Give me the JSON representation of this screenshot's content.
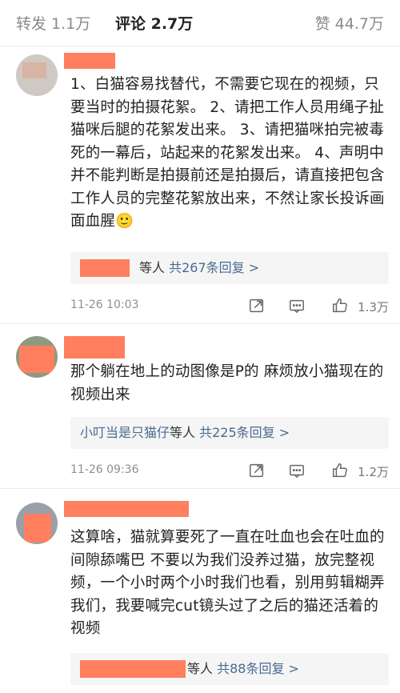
{
  "tabs": {
    "repost": "转发 1.1万",
    "comments": "评论 2.7万",
    "likes": "赞 44.7万"
  },
  "comments": [
    {
      "text": "1、白猫容易找替代，不需要它现在的视频，只要当时的拍摄花絮。 2、请把工作人员用绳子扯猫咪后腿的花絮发出来。 3、请把猫咪拍完被毒死的一幕后，站起来的花絮发出来。 4、声明中并不能判断是拍摄前还是拍摄后，请直接把包含工作人员的完整花絮放出来，不然让家长投诉画面血腥🙂",
      "reply_suffix": "等人",
      "reply_link": "共267条回复 >",
      "time": "11-26 10:03",
      "likes": "1.3万"
    },
    {
      "text": "那个躺在地上的动图像是P的 麻烦放小猫现在的视频出来",
      "reply_user": "小叮当是只猫仔",
      "reply_suffix": "等人",
      "reply_link": "共225条回复 >",
      "time": "11-26 09:36",
      "likes": "1.2万"
    },
    {
      "text": "这算啥，猫就算要死了一直在吐血也会在吐血的间隙舔嘴巴 不要以为我们没养过猫，放完整视频，一个小时两个小时我们也看，别用剪辑糊弄我们，我要喊完cut镜头过了之后的猫还活着的视频",
      "reply_suffix": "等人",
      "reply_link": "共88条回复 >"
    }
  ],
  "icons": [
    "share-icon",
    "comment-icon",
    "like-icon",
    "chevron-right-icon"
  ],
  "colors": {
    "accent_link": "#4a6a92",
    "redaction": "#ff7f5f",
    "muted": "#8f8f8f"
  }
}
